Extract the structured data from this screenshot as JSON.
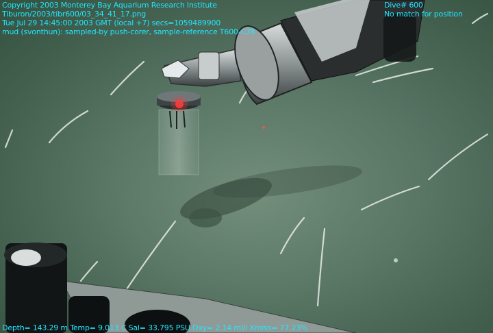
{
  "overlay": {
    "copyright": "Copyright 2003 Monterey Bay Aquarium Research Institute",
    "file_path": "Tiburon/2003/tibr600/03_34_41_17.png",
    "timestamp": "Tue Jul 29 14:45:00 2003 GMT (local +7)  secs=1059489900",
    "annotation": "mud (svonthun): sampled-by push-corer, sample-reference T600-C78",
    "dive": "Dive# 600",
    "position_status": "No match for position",
    "sensors": "Depth= 143.29 m  Temp= 9.013 C  Sal= 33.795 PSU  Oxy= 2.14 ml/l  Xmiss= 77.23%"
  },
  "colors": {
    "overlay_text": "#22e6ff",
    "seafloor": "#5b7868"
  },
  "scene": {
    "subject": "ROV manipulator arm holding push-core over muddy seafloor with sea whips"
  }
}
